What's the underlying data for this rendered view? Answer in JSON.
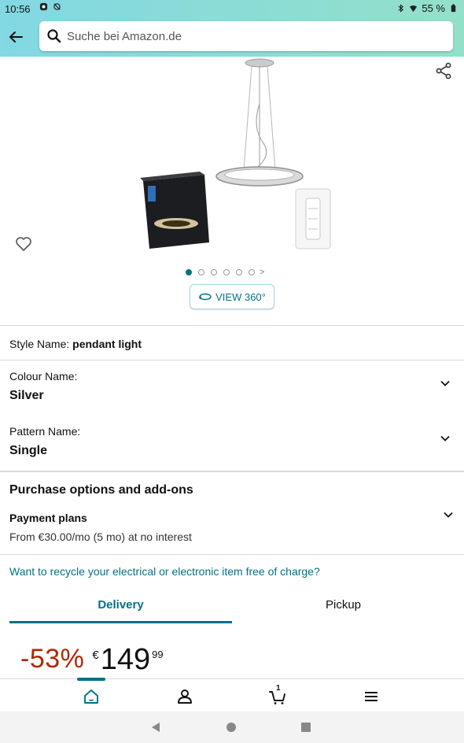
{
  "status_bar": {
    "time": "10:56",
    "battery": "55 %"
  },
  "search": {
    "placeholder": "Suche bei Amazon.de",
    "value": ""
  },
  "gallery": {
    "view360_label": "VIEW 360°",
    "image_count": 6,
    "active_index": 0
  },
  "variations": {
    "style_label": "Style Name:",
    "style_value": "pendant light",
    "colour_label": "Colour Name:",
    "colour_value": "Silver",
    "pattern_label": "Pattern Name:",
    "pattern_value": "Single"
  },
  "purchase": {
    "section_title": "Purchase options and add-ons",
    "payment_title": "Payment plans",
    "payment_subtitle": "From €30.00/mo (5 mo) at no interest"
  },
  "recycle_link": "Want to recycle your electrical or electronic item free of charge?",
  "tabs": {
    "delivery": "Delivery",
    "pickup": "Pickup",
    "active": "Delivery"
  },
  "price": {
    "discount": "-53%",
    "currency": "€",
    "whole": "149",
    "fraction": "99"
  },
  "bottom_nav": {
    "cart_count": "1",
    "active": "home"
  },
  "colors": {
    "accent": "#007185",
    "discount": "#b12704",
    "header_gradient_start": "#82d8e3",
    "header_gradient_end": "#93e0c9"
  }
}
